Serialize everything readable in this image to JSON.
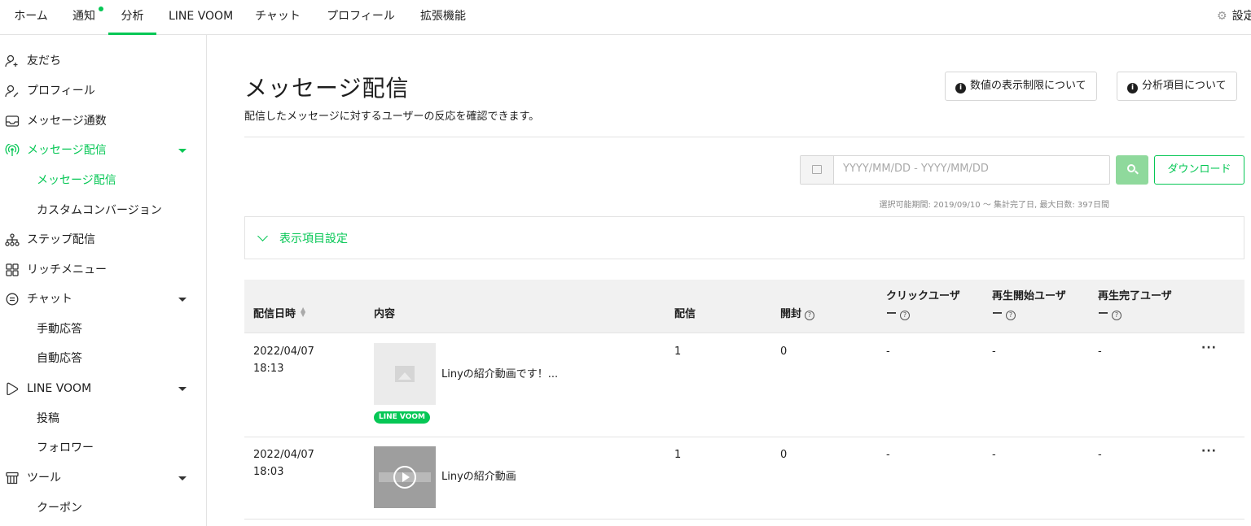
{
  "topnav": {
    "tabs": [
      "ホーム",
      "通知",
      "分析",
      "LINE VOOM",
      "チャット",
      "プロフィール",
      "拡張機能"
    ],
    "active_tab": "分析",
    "settings_label": "設定"
  },
  "sidebar": {
    "items": [
      {
        "label": "友だち",
        "icon": "add-friend-icon"
      },
      {
        "label": "プロフィール",
        "icon": "profile-icon"
      },
      {
        "label": "メッセージ通数",
        "icon": "inbox-icon"
      },
      {
        "label": "メッセージ配信",
        "icon": "broadcast-icon",
        "expanded": true,
        "active": true
      },
      {
        "label": "メッセージ配信",
        "sub": true,
        "active": true
      },
      {
        "label": "カスタムコンバージョン",
        "sub": true
      },
      {
        "label": "ステップ配信",
        "icon": "step-icon"
      },
      {
        "label": "リッチメニュー",
        "icon": "grid-icon"
      },
      {
        "label": "チャット",
        "icon": "chat-icon",
        "expanded": true
      },
      {
        "label": "手動応答",
        "sub": true
      },
      {
        "label": "自動応答",
        "sub": true
      },
      {
        "label": "LINE VOOM",
        "icon": "voom-icon",
        "expanded": true
      },
      {
        "label": "投稿",
        "sub": true
      },
      {
        "label": "フォロワー",
        "sub": true
      },
      {
        "label": "ツール",
        "icon": "tool-icon",
        "expanded": true
      },
      {
        "label": "クーポン",
        "sub": true
      }
    ]
  },
  "main": {
    "title": "メッセージ配信",
    "description": "配信したメッセージに対するユーザーの反応を確認できます。",
    "buttons": {
      "display_limit": "数値の表示制限について",
      "analysis_items": "分析項目について",
      "download": "ダウンロード"
    },
    "date_range": {
      "placeholder": "YYYY/MM/DD - YYYY/MM/DD",
      "note": "選択可能期間: 2019/09/10 〜 集計完了日, 最大日数: 397日間"
    },
    "display_settings_label": "表示項目設定",
    "table": {
      "headers": {
        "date": "配信日時",
        "content": "内容",
        "delivered": "配信",
        "opened": "開封",
        "click_users_1": "クリックユーザ",
        "click_users_2": "ー",
        "play_start_1": "再生開始ユーザ",
        "play_start_2": "ー",
        "play_complete_1": "再生完了ユーザ",
        "play_complete_2": "ー"
      },
      "rows": [
        {
          "date": "2022/04/07",
          "time": "18:13",
          "content": "Linyの紹介動画です！...",
          "badge": "LINE VOOM",
          "delivered": "1",
          "opened": "0",
          "click": "-",
          "play_start": "-",
          "play_complete": "-",
          "more": "···"
        },
        {
          "date": "2022/04/07",
          "time": "18:03",
          "content": "Linyの紹介動画",
          "delivered": "1",
          "opened": "0",
          "click": "-",
          "play_start": "-",
          "play_complete": "-",
          "more": "···"
        }
      ]
    }
  },
  "colors": {
    "accent": "#06c755",
    "search_button": "#8fd99c",
    "header_bg": "#f1f1f1"
  }
}
